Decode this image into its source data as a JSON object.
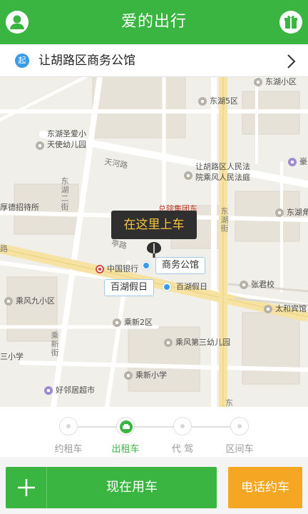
{
  "header": {
    "title": "爱的出行",
    "left_icon": "user-icon",
    "right_icon": "gift-icon"
  },
  "start": {
    "badge": "起",
    "address": "让胡路区商务公馆"
  },
  "map": {
    "pickup_hint": "在这里上车",
    "callout_main": "商务公馆",
    "callout_secondary": "百湖假日",
    "pois": {
      "dhxq": "东湖小区",
      "dh5q": "东湖5区",
      "sax": "东湖圣爱小",
      "sax2": "天使幼儿园",
      "court1": "让胡路区人民法",
      "court2": "院乘风人民法庭",
      "hao": "豪",
      "bank": "中国银行",
      "bhjr": "百湖假日",
      "zjx": "张君校",
      "thbg": "太和宾馆",
      "cfjxq": "乘风九小区",
      "cx2q": "乘新2区",
      "cf3yey": "乘风第三幼儿园",
      "cxxx": "乘新小学",
      "sanxx": "三小学",
      "hljcs": "好邻居超市",
      "hddzs": "厚德招待所",
      "dhj": "东湖角"
    },
    "roads": {
      "tianhe": "天河路",
      "donghu2": "东湖二街",
      "donghujie": "东湖街",
      "chengxin": "乘新街",
      "lu": "路",
      "ting": "亭路",
      "dong": "东"
    },
    "red_label": "总院集团东"
  },
  "modes": [
    {
      "label": "约租车",
      "active": false
    },
    {
      "label": "出租车",
      "active": true
    },
    {
      "label": "代 驾",
      "active": false
    },
    {
      "label": "区间车",
      "active": false
    }
  ],
  "actions": {
    "now": "现在用车",
    "phone": "电话约车"
  },
  "colors": {
    "brand_green": "#3bb541",
    "accent_orange": "#f5a623",
    "pickup_yellow": "#f5c542",
    "location_blue": "#3a9be6"
  }
}
